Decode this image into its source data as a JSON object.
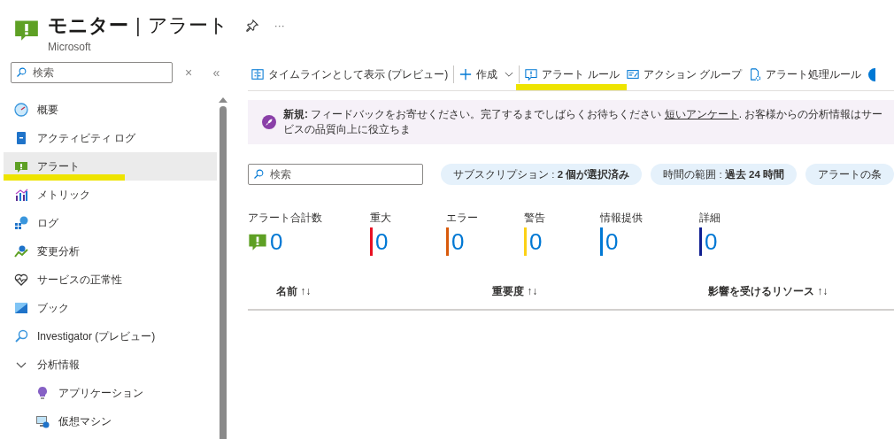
{
  "header": {
    "title": "モニター",
    "separator": "|",
    "subtitle": "アラート",
    "publisher": "Microsoft",
    "more": "···"
  },
  "sidebar": {
    "search": {
      "placeholder": "検索"
    },
    "clear": "×",
    "collapse": "«",
    "items": [
      {
        "label": "概要",
        "selected": false
      },
      {
        "label": "アクティビティ ログ",
        "selected": false
      },
      {
        "label": "アラート",
        "selected": true,
        "highlighted": true
      },
      {
        "label": "メトリック",
        "selected": false
      },
      {
        "label": "ログ",
        "selected": false
      },
      {
        "label": "変更分析",
        "selected": false
      },
      {
        "label": "サービスの正常性",
        "selected": false
      },
      {
        "label": "ブック",
        "selected": false
      },
      {
        "label": "Investigator (プレビュー)",
        "selected": false
      },
      {
        "label": "分析情報",
        "selected": false,
        "expanded": true,
        "children": [
          {
            "label": "アプリケーション",
            "selected": false
          },
          {
            "label": "仮想マシン",
            "selected": false
          }
        ]
      }
    ]
  },
  "toolbar": [
    {
      "label": "タイムラインとして表示 (プレビュー)"
    },
    {
      "label": "作成",
      "dropdown": true
    },
    {
      "label": "アラート ルール",
      "highlighted": true
    },
    {
      "label": "アクション グループ"
    },
    {
      "label": "アラート処理ルール"
    }
  ],
  "banner": {
    "message_start": "**新規:** フィードバックをお寄せください。完了するまでしばらくお待ちください",
    "link": "短いアンケート",
    "message_end": ". お客様からの分析情報はサービスの品質向上に役立ちま"
  },
  "filters": {
    "search": {
      "placeholder": "検索"
    },
    "pills": [
      "サブスクリプション : **2 個が選択済み**",
      "時間の範囲 : **過去 24 時間**",
      "アラートの条"
    ]
  },
  "metrics": [
    {
      "label": "アラート合計数",
      "value": "0",
      "kind": "icon"
    },
    {
      "label": "重大",
      "value": "0",
      "kind": "bar",
      "color": "#e81123"
    },
    {
      "label": "エラー",
      "value": "0",
      "kind": "bar",
      "color": "#d85a0b"
    },
    {
      "label": "警告",
      "value": "0",
      "kind": "bar",
      "color": "#fcd116"
    },
    {
      "label": "情報提供",
      "value": "0",
      "kind": "bar",
      "color": "#0078d4"
    },
    {
      "label": "詳細",
      "value": "0",
      "kind": "bar",
      "color": "#101f91"
    }
  ],
  "table": {
    "columns": [
      "名前",
      "重要度",
      "影響を受けるリソース"
    ],
    "sort_icon": "↑↓"
  }
}
